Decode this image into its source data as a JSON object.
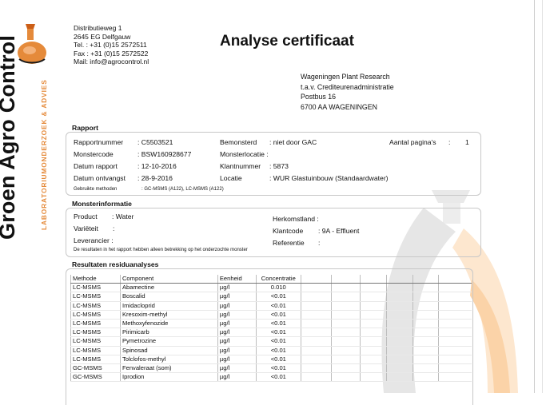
{
  "logo": {
    "name": "Groen Agro Control",
    "subtitle": "LABORATORIUMONDERZOEK & ADVIES",
    "icon": "flask-icon",
    "accent": "#e58a3a"
  },
  "sender": {
    "street": "Distributieweg 1",
    "city": "2645 EG  Delfgauw",
    "tel": "Tel. : +31 (0)15 2572511",
    "fax": "Fax : +31 (0)15 2572522",
    "mail": "Mail: info@agrocontrol.nl"
  },
  "title": "Analyse certificaat",
  "recipient": {
    "line1": "Wageningen Plant Research",
    "line2": "t.a.v. Crediteurenadministratie",
    "line3": "Postbus 16",
    "line4": "6700 AA  WAGENINGEN"
  },
  "rapport": {
    "title": "Rapport",
    "rapportnummer_label": "Rapportnummer",
    "rapportnummer_value": ":  C5503521",
    "monstercode_label": "Monstercode",
    "monstercode_value": ":  BSW160928677",
    "datum_rapport_label": "Datum rapport",
    "datum_rapport_value": ":  12-10-2016",
    "datum_ontvangst_label": "Datum ontvangst",
    "datum_ontvangst_value": ":  28-9-2016",
    "methoden_label": "Gebruikte methoden",
    "methoden_value": ":  GC-MSMS (A122), LC-MSMS (A122)",
    "bemonsterd_label": "Bemonsterd",
    "bemonsterd_value": ": niet door GAC",
    "monsterlocatie_label": "Monsterlocatie :",
    "klantnummer_label": "Klantnummer",
    "klantnummer_value": ": 5873",
    "locatie_label": "Locatie",
    "locatie_value": ": WUR Glastuinbouw (Standaardwater)",
    "paginas_label": "Aantal pagina's",
    "paginas_sep": ":",
    "paginas_value": "1"
  },
  "monster": {
    "title": "Monsterinformatie",
    "product_label": "Product",
    "product_value": ":  Water",
    "varieteit_label": "Variëteit",
    "varieteit_value": ":",
    "leverancier_label": "Leverancier :",
    "note": "De resultaten in het rapport hebben alleen betrekking op het onderzochte monster",
    "herkomstland_label": "Herkomstland :",
    "klantcode_label": "Klantcode",
    "klantcode_value": ":   9A - Effluent",
    "referentie_label": "Referentie",
    "referentie_value": ":"
  },
  "results": {
    "title": "Resultaten residuanalyses",
    "headers": [
      "Methode",
      "Component",
      "Eenheid",
      "Concentratie"
    ],
    "rows": [
      [
        "LC-MSMS",
        "Abamectine",
        "µg/l",
        "0.010"
      ],
      [
        "LC-MSMS",
        "Boscalid",
        "µg/l",
        "<0.01"
      ],
      [
        "LC-MSMS",
        "Imidacloprid",
        "µg/l",
        "<0.01"
      ],
      [
        "LC-MSMS",
        "Kresoxim-methyl",
        "µg/l",
        "<0.01"
      ],
      [
        "LC-MSMS",
        "Methoxyfenozide",
        "µg/l",
        "<0.01"
      ],
      [
        "LC-MSMS",
        "Pirimicarb",
        "µg/l",
        "<0.01"
      ],
      [
        "LC-MSMS",
        "Pymetrozine",
        "µg/l",
        "<0.01"
      ],
      [
        "LC-MSMS",
        "Spinosad",
        "µg/l",
        "<0.01"
      ],
      [
        "LC-MSMS",
        "Tolclofos-methyl",
        "µg/l",
        "<0.01"
      ],
      [
        "GC-MSMS",
        "Fenvaleraat (som)",
        "µg/l",
        "<0.01"
      ],
      [
        "GC-MSMS",
        "Iprodion",
        "µg/l",
        "<0.01"
      ]
    ]
  }
}
